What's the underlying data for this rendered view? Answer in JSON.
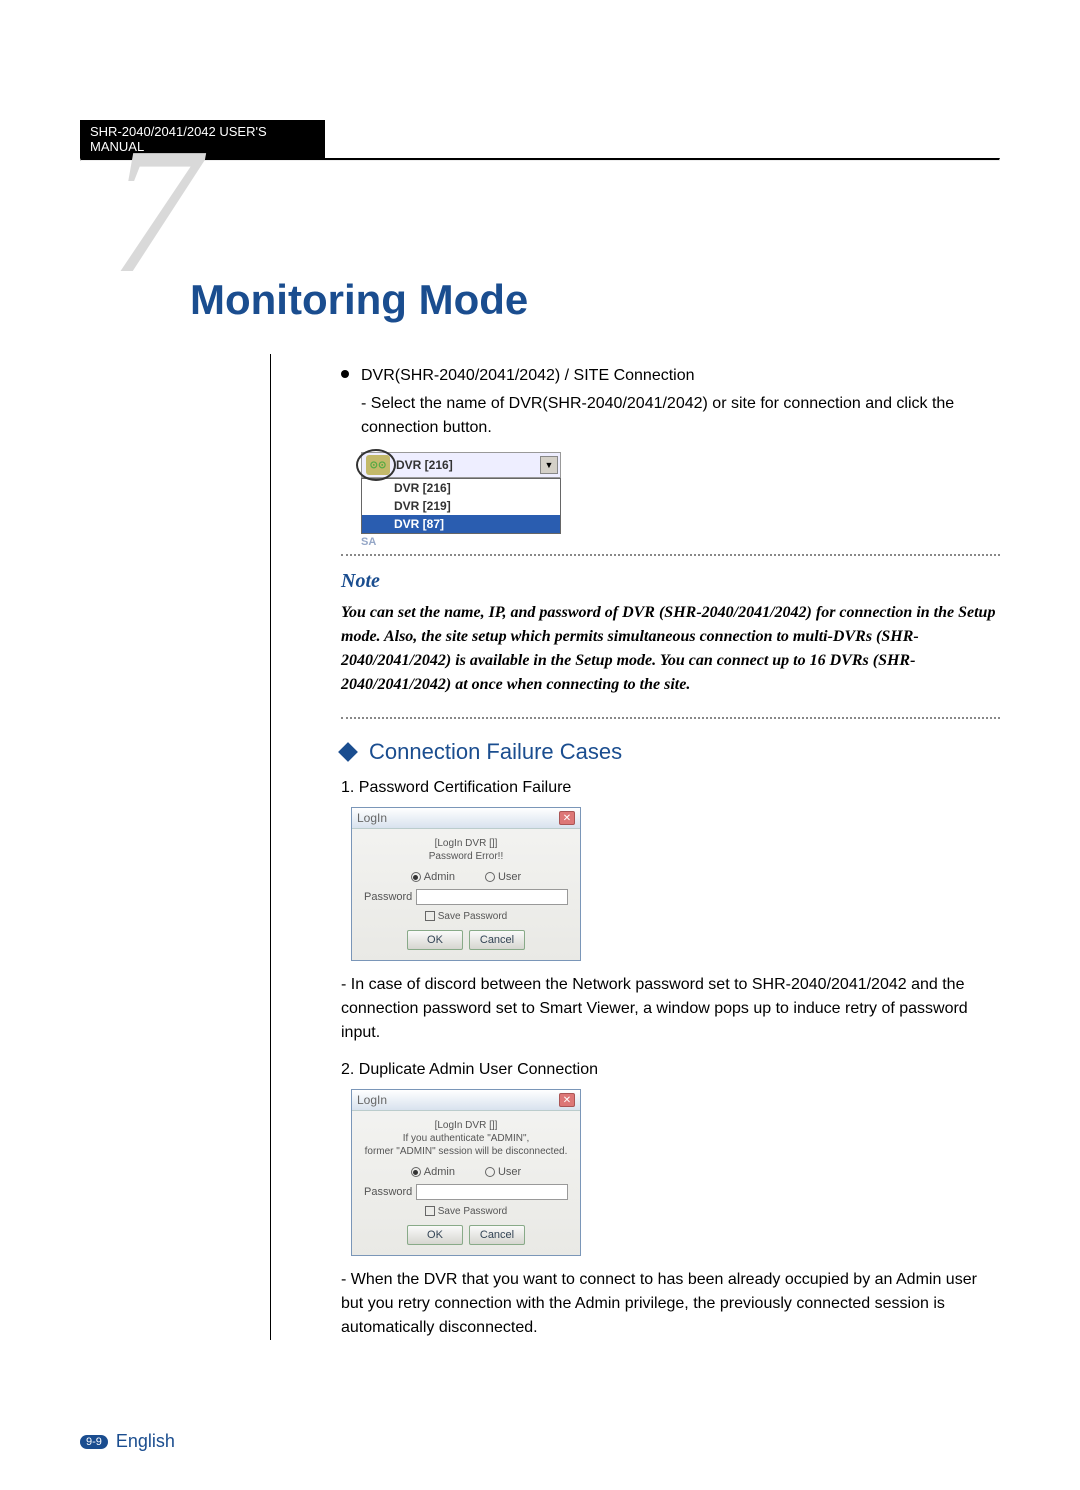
{
  "header": {
    "manual": "SHR-2040/2041/2042 USER'S MANUAL"
  },
  "chapter": {
    "number": "7",
    "title": "Monitoring Mode"
  },
  "intro": {
    "bullet": "DVR(SHR-2040/2041/2042) / SITE Connection",
    "sub": "- Select the name of DVR(SHR-2040/2041/2042) or site for connection and click the connection button."
  },
  "dropdown": {
    "selected": "DVR [216]",
    "items": [
      "DVR [216]",
      "DVR [219]",
      "DVR [87]"
    ],
    "watermark": "SA"
  },
  "note": {
    "title": "Note",
    "body": "You can set the name, IP, and password of DVR (SHR-2040/2041/2042) for connection in the Setup mode. Also, the site setup which permits simultaneous connection to multi-DVRs (SHR-2040/2041/2042) is available in the Setup mode. You can connect up to 16 DVRs (SHR-2040/2041/2042) at once when connecting to the site."
  },
  "section": {
    "title": "Connection Failure Cases"
  },
  "case1": {
    "heading": "1. Password Certification Failure",
    "dialog": {
      "title": "LogIn",
      "msg": "[LogIn DVR []]\nPassword Error!!",
      "radio_admin": "Admin",
      "radio_user": "User",
      "pw_label": "Password",
      "save": "Save Password",
      "ok": "OK",
      "cancel": "Cancel"
    },
    "desc": "- In case of discord between the Network password set to SHR-2040/2041/2042 and the connection password set to Smart Viewer, a window pops up to induce retry of password input."
  },
  "case2": {
    "heading": "2. Duplicate Admin User Connection",
    "dialog": {
      "title": "LogIn",
      "msg": "[LogIn DVR []]\nIf you authenticate \"ADMIN\",\nformer \"ADMIN\" session will be disconnected.",
      "radio_admin": "Admin",
      "radio_user": "User",
      "pw_label": "Password",
      "save": "Save Password",
      "ok": "OK",
      "cancel": "Cancel"
    },
    "desc": "- When the DVR that you want to connect to has been already occupied by an Admin user but you retry connection with the Admin privilege, the previously connected session is automatically disconnected."
  },
  "footer": {
    "page": "9-9",
    "lang": "English"
  }
}
